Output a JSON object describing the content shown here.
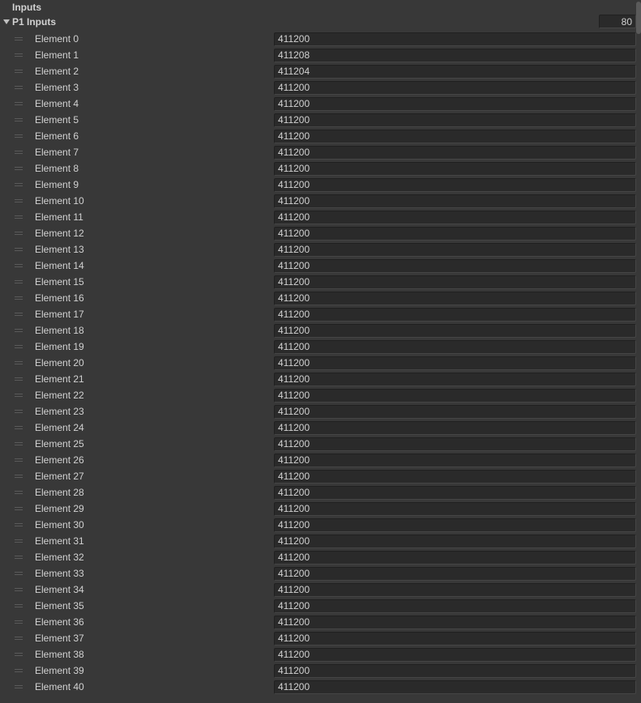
{
  "header": {
    "label": "Inputs"
  },
  "array": {
    "title": "P1 Inputs",
    "size": "80",
    "elements": [
      {
        "label": "Element 0",
        "value": "411200"
      },
      {
        "label": "Element 1",
        "value": "411208"
      },
      {
        "label": "Element 2",
        "value": "411204"
      },
      {
        "label": "Element 3",
        "value": "411200"
      },
      {
        "label": "Element 4",
        "value": "411200"
      },
      {
        "label": "Element 5",
        "value": "411200"
      },
      {
        "label": "Element 6",
        "value": "411200"
      },
      {
        "label": "Element 7",
        "value": "411200"
      },
      {
        "label": "Element 8",
        "value": "411200"
      },
      {
        "label": "Element 9",
        "value": "411200"
      },
      {
        "label": "Element 10",
        "value": "411200"
      },
      {
        "label": "Element 11",
        "value": "411200"
      },
      {
        "label": "Element 12",
        "value": "411200"
      },
      {
        "label": "Element 13",
        "value": "411200"
      },
      {
        "label": "Element 14",
        "value": "411200"
      },
      {
        "label": "Element 15",
        "value": "411200"
      },
      {
        "label": "Element 16",
        "value": "411200"
      },
      {
        "label": "Element 17",
        "value": "411200"
      },
      {
        "label": "Element 18",
        "value": "411200"
      },
      {
        "label": "Element 19",
        "value": "411200"
      },
      {
        "label": "Element 20",
        "value": "411200"
      },
      {
        "label": "Element 21",
        "value": "411200"
      },
      {
        "label": "Element 22",
        "value": "411200"
      },
      {
        "label": "Element 23",
        "value": "411200"
      },
      {
        "label": "Element 24",
        "value": "411200"
      },
      {
        "label": "Element 25",
        "value": "411200"
      },
      {
        "label": "Element 26",
        "value": "411200"
      },
      {
        "label": "Element 27",
        "value": "411200"
      },
      {
        "label": "Element 28",
        "value": "411200"
      },
      {
        "label": "Element 29",
        "value": "411200"
      },
      {
        "label": "Element 30",
        "value": "411200"
      },
      {
        "label": "Element 31",
        "value": "411200"
      },
      {
        "label": "Element 32",
        "value": "411200"
      },
      {
        "label": "Element 33",
        "value": "411200"
      },
      {
        "label": "Element 34",
        "value": "411200"
      },
      {
        "label": "Element 35",
        "value": "411200"
      },
      {
        "label": "Element 36",
        "value": "411200"
      },
      {
        "label": "Element 37",
        "value": "411200"
      },
      {
        "label": "Element 38",
        "value": "411200"
      },
      {
        "label": "Element 39",
        "value": "411200"
      },
      {
        "label": "Element 40",
        "value": "411200"
      }
    ]
  }
}
